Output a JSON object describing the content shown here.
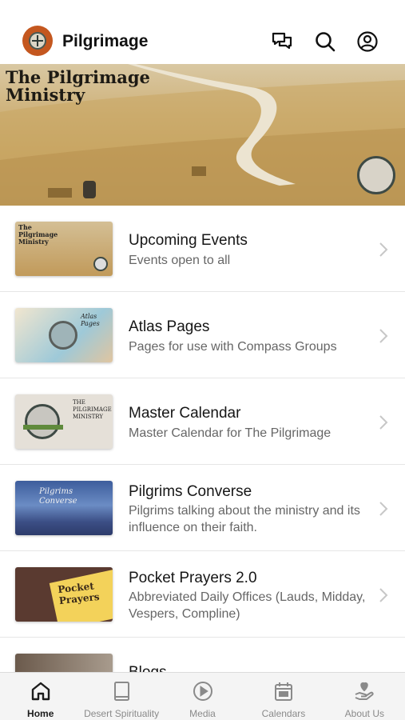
{
  "header": {
    "title": "Pilgrimage",
    "icons": [
      "chat-icon",
      "search-icon",
      "profile-icon"
    ]
  },
  "hero": {
    "title_line1": "The Pilgrimage",
    "title_line2": "Ministry"
  },
  "items": [
    {
      "title": "Upcoming Events",
      "subtitle": "Events open to all",
      "thumb_text": "The Pilgrimage Ministry"
    },
    {
      "title": "Atlas Pages",
      "subtitle": "Pages for use with Compass Groups",
      "thumb_text": "Atlas Pages"
    },
    {
      "title": "Master Calendar",
      "subtitle": "Master Calendar for The Pilgrimage",
      "thumb_text": "THE PILGRIMAGE MINISTRY"
    },
    {
      "title": "Pilgrims Converse",
      "subtitle": "Pilgrims talking about the ministry and its influence on their faith.",
      "thumb_text": "Pilgrims Converse"
    },
    {
      "title": "Pocket Prayers 2.0",
      "subtitle": "Abbreviated Daily Offices (Lauds, Midday, Vespers, Compline)",
      "thumb_text": "Pocket Prayers"
    },
    {
      "title": "Blogs",
      "subtitle": ""
    }
  ],
  "tabs": [
    {
      "label": "Home",
      "icon": "home-icon",
      "active": true
    },
    {
      "label": "Desert Spirituality",
      "icon": "book-icon",
      "active": false
    },
    {
      "label": "Media",
      "icon": "play-icon",
      "active": false
    },
    {
      "label": "Calendars",
      "icon": "calendar-icon",
      "active": false
    },
    {
      "label": "About Us",
      "icon": "hand-heart-icon",
      "active": false
    }
  ],
  "colors": {
    "logo": "#c4571f",
    "active_tab": "#1c1c1c",
    "inactive_tab": "#8a8a8a"
  }
}
